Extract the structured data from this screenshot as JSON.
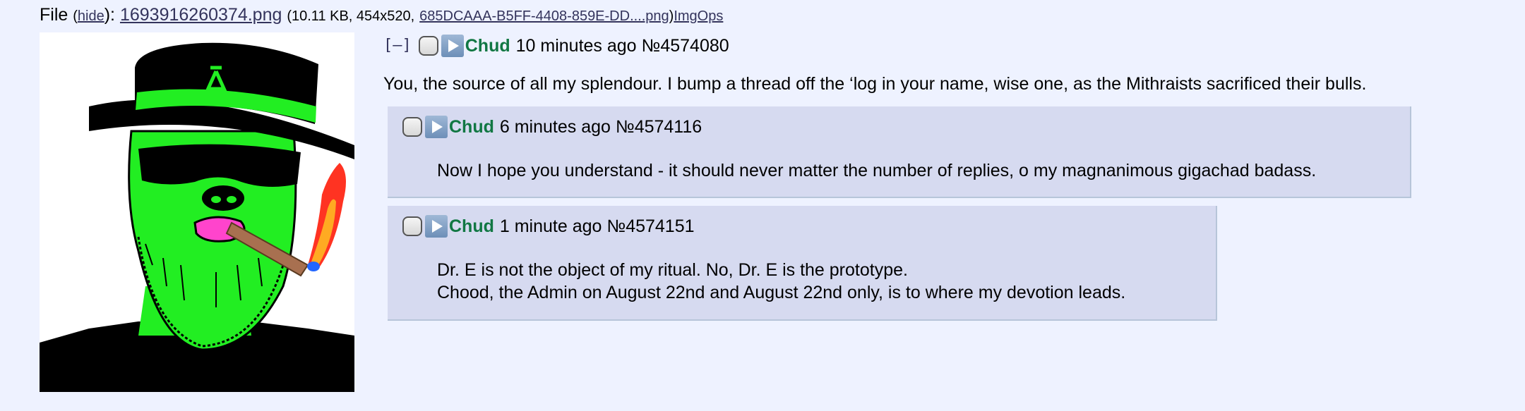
{
  "file": {
    "label": "File",
    "open_paren": "(",
    "hide_link": "hide",
    "close_paren": "):",
    "filename": "1693916260374.png",
    "meta_prefix": "(10.11 KB, 454x520,",
    "original_name": "685DCAAA-B5FF-4408-859E-DD....png",
    "meta_suffix": ")",
    "imgops": "ImgOps"
  },
  "op": {
    "hide_toggle": "[–]",
    "name": "Chud",
    "time": "10 minutes ago",
    "post_no": "№4574080",
    "message": "You, the source of all my splendour. I bump a thread off the ‘log in your name, wise one, as the Mithraists sacrificed their bulls."
  },
  "replies": [
    {
      "name": "Chud",
      "time": "6 minutes ago",
      "post_no": "№4574116",
      "lines": [
        "Now I hope you understand - it should never matter the number of replies, o my magnanimous gigachad badass."
      ]
    },
    {
      "name": "Chud",
      "time": "1 minute ago",
      "post_no": "№4574151",
      "lines": [
        "Dr. E is not the object of my ritual. No, Dr. E is the prototype.",
        "Chood, the Admin on August 22nd and August 22nd only, is to where my devotion leads."
      ]
    }
  ],
  "colors": {
    "page_bg": "#eef2ff",
    "reply_bg": "#d6daf0",
    "name": "#117743",
    "link": "#34345c"
  }
}
